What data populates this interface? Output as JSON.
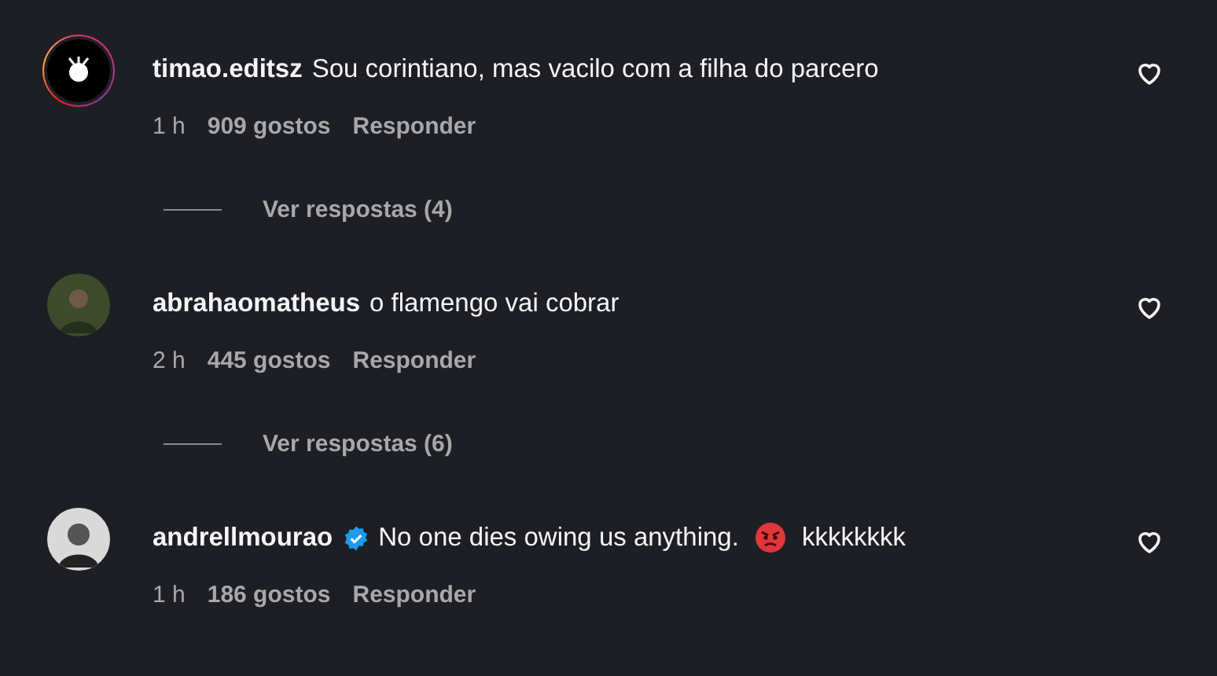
{
  "comments": [
    {
      "username": "timao.editsz",
      "verified": false,
      "story_ring": true,
      "kind": "logo",
      "text": "Sou corintiano, mas vacilo com a filha do parcero",
      "emoji": false,
      "time": "1 h",
      "likes": "909 gostos",
      "reply": "Responder",
      "view_replies": "Ver respostas (4)"
    },
    {
      "username": "abrahaomatheus",
      "verified": false,
      "story_ring": false,
      "kind": "photo",
      "text": "o flamengo vai cobrar",
      "emoji": false,
      "time": "2 h",
      "likes": "445 gostos",
      "reply": "Responder",
      "view_replies": "Ver respostas (6)"
    },
    {
      "username": "andrellmourao",
      "verified": true,
      "story_ring": false,
      "kind": "person",
      "text": "No one dies owing us anything.",
      "emoji": true,
      "text_after": "kkkkkkkk",
      "time": "1 h",
      "likes": "186 gostos",
      "reply": "Responder"
    }
  ]
}
